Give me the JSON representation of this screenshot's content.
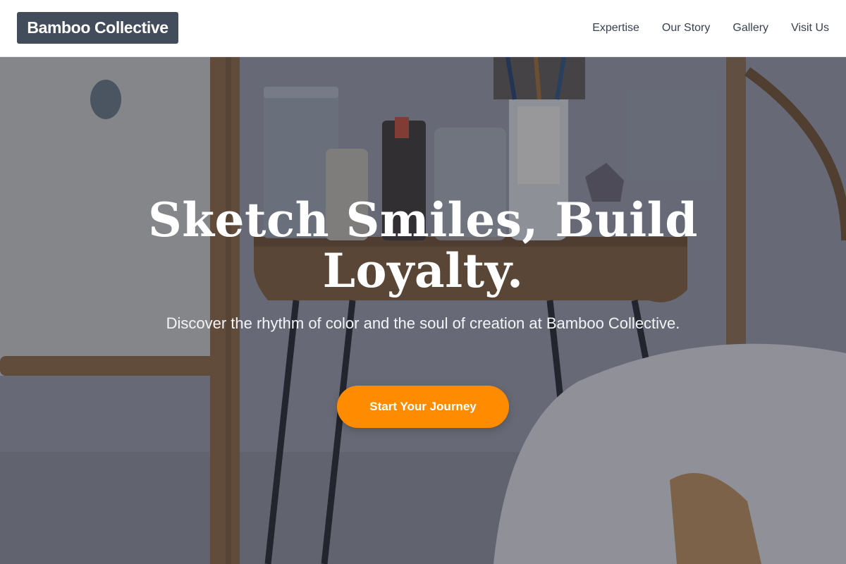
{
  "header": {
    "brand": "Bamboo Collective",
    "nav": [
      {
        "label": "Expertise"
      },
      {
        "label": "Our Story"
      },
      {
        "label": "Gallery"
      },
      {
        "label": "Visit Us"
      }
    ]
  },
  "hero": {
    "headline_line1": "Sketch Smiles, Build",
    "headline_line2": "Loyalty.",
    "subline": "Discover the rhythm of color and the soul of creation at Bamboo Collective.",
    "cta_label": "Start Your Journey"
  },
  "colors": {
    "brand_bg": "#434c5a",
    "accent": "#ff8c00",
    "nav_text": "#374151"
  }
}
